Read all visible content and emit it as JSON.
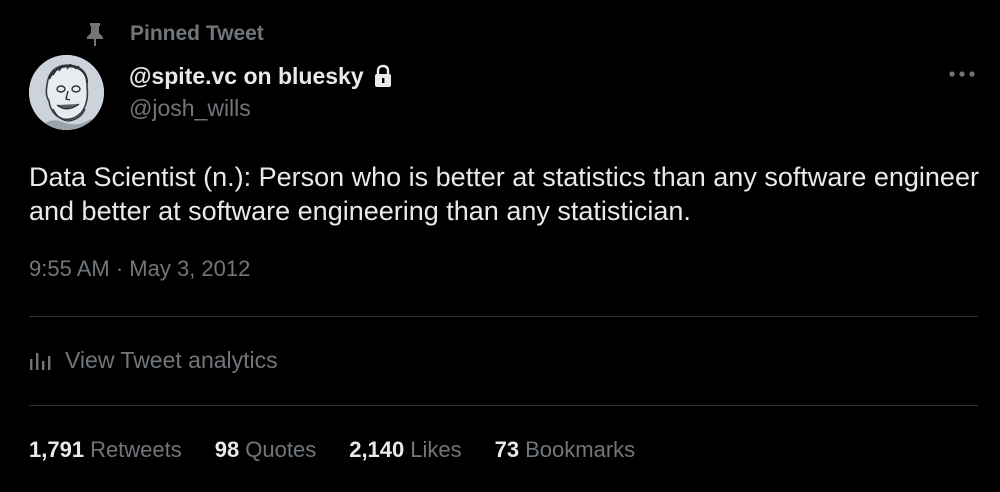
{
  "pinned": {
    "icon": "pin-icon",
    "label": "Pinned Tweet"
  },
  "author": {
    "display_name": "@spite.vc on bluesky",
    "handle": "@josh_wills",
    "protected_icon": "lock-icon",
    "avatar": "avatar"
  },
  "more_icon": "more-horizontal-icon",
  "tweet": {
    "text": "Data Scientist (n.): Person who is better at statistics than any software engineer and better at software engineering than any statistician.",
    "time": "9:55 AM",
    "separator": "·",
    "date": "May 3, 2012"
  },
  "analytics": {
    "icon": "analytics-icon",
    "label": "View Tweet analytics"
  },
  "stats": [
    {
      "count": "1,791",
      "label": "Retweets"
    },
    {
      "count": "98",
      "label": "Quotes"
    },
    {
      "count": "2,140",
      "label": "Likes"
    },
    {
      "count": "73",
      "label": "Bookmarks"
    }
  ],
  "colors": {
    "background": "#000000",
    "primary_text": "#e7e9ea",
    "secondary_text": "#71767b",
    "divider": "#2f3336"
  }
}
